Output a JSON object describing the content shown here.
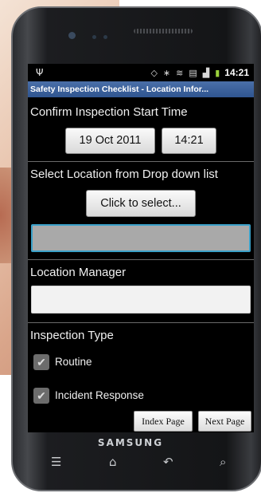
{
  "device": {
    "brand": "SAMSUNG"
  },
  "statusbar": {
    "time": "14:21",
    "icons": [
      "usb-icon",
      "gps-icon",
      "bluetooth-icon",
      "wifi-icon",
      "sd-icon",
      "signal-icon",
      "battery-icon"
    ],
    "battery_color": "#9bd23c"
  },
  "app": {
    "title": "Safety Inspection Checklist - Location Infor..."
  },
  "form": {
    "start_time_label": "Confirm Inspection Start Time",
    "date_value": "19 Oct 2011",
    "time_value": "14:21",
    "location_label": "Select Location from Drop down list",
    "location_button": "Click to select...",
    "location_value": "",
    "manager_label": "Location Manager",
    "manager_value": "",
    "inspection_type_label": "Inspection Type",
    "inspection_types": [
      {
        "label": "Routine",
        "checked": true
      },
      {
        "label": "Incident Response",
        "checked": true
      }
    ]
  },
  "footer_buttons": {
    "index": "Index Page",
    "next": "Next Page"
  },
  "softkeys": [
    "menu-icon",
    "home-icon",
    "back-icon",
    "search-icon"
  ],
  "colors": {
    "titlebar": "#3a62a0",
    "field_focus": "#3aa0c8"
  }
}
